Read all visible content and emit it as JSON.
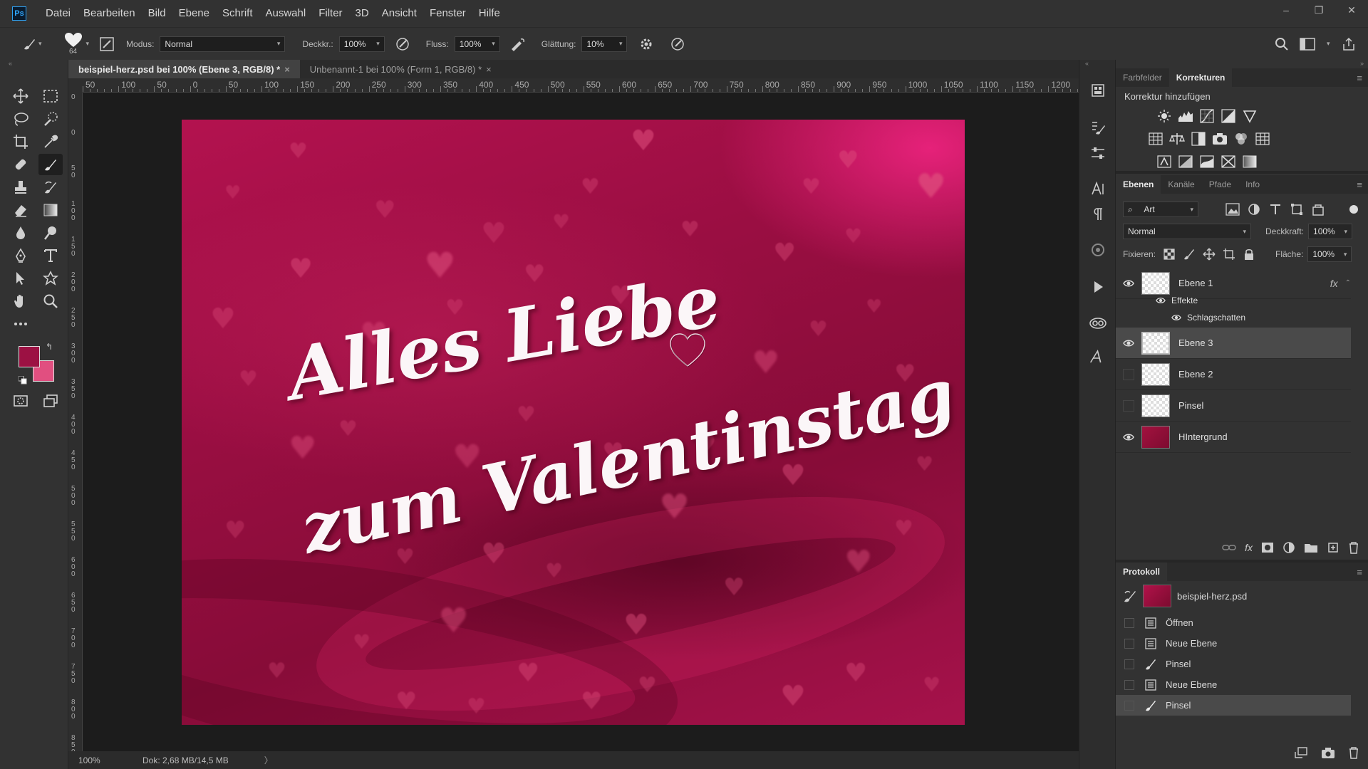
{
  "app": {
    "logo": "Ps",
    "menu": [
      "Datei",
      "Bearbeiten",
      "Bild",
      "Ebene",
      "Schrift",
      "Auswahl",
      "Filter",
      "3D",
      "Ansicht",
      "Fenster",
      "Hilfe"
    ],
    "window_controls": [
      "–",
      "❐",
      "✕"
    ]
  },
  "options": {
    "brush_size": "64",
    "modus_label": "Modus:",
    "modus_value": "Normal",
    "deckkr_label": "Deckkr.:",
    "deckkr_value": "100%",
    "fluss_label": "Fluss:",
    "fluss_value": "100%",
    "glaettung_label": "Glättung:",
    "glaettung_value": "10%"
  },
  "tabs": [
    {
      "label": "beispiel-herz.psd bei 100% (Ebene 3, RGB/8) *",
      "active": true
    },
    {
      "label": "Unbenannt-1 bei 100% (Form 1, RGB/8) *",
      "active": false
    }
  ],
  "ruler": {
    "h_labels": [
      "50",
      "100",
      "50",
      "0",
      "50",
      "100",
      "150",
      "200",
      "250",
      "300",
      "350",
      "400",
      "450",
      "500",
      "550",
      "600",
      "650",
      "700",
      "750",
      "800",
      "850",
      "900",
      "950",
      "1000",
      "1050",
      "1100",
      "1150",
      "1200"
    ],
    "v_labels": [
      "0",
      "0",
      "5 0",
      "1 0 0",
      "1 5 0",
      "2 0 0",
      "2 5 0",
      "3 0 0",
      "3 5 0",
      "4 0 0",
      "4 5 0",
      "5 0 0",
      "5 5 0",
      "6 0 0",
      "6 5 0",
      "7 0 0",
      "7 5 0",
      "8 0 0",
      "8 5 0"
    ]
  },
  "canvas": {
    "line1": "Alles Liebe",
    "line2": "zum Valentinstag",
    "heart_glyph": "♥"
  },
  "colors": {
    "foreground": "#9c1143",
    "background": "#e14f80"
  },
  "status": {
    "zoom": "100%",
    "doc": "Dok: 2,68 MB/14,5 MB",
    "arrow": "〉"
  },
  "corrections": {
    "tabs": [
      "Farbfelder",
      "Korrekturen"
    ],
    "active_tab": "Korrekturen",
    "title": "Korrektur hinzufügen"
  },
  "layers_panel": {
    "tabs": [
      "Ebenen",
      "Kanäle",
      "Pfade",
      "Info"
    ],
    "filter_kind": "Art",
    "blend_mode": "Normal",
    "opacity_label": "Deckkraft:",
    "opacity_value": "100%",
    "lock_label": "Fixieren:",
    "fill_label": "Fläche:",
    "fill_value": "100%",
    "fx_label": "fx",
    "layers": [
      {
        "name": "Ebene 1",
        "visible": true,
        "selected": false,
        "thumb": "check"
      },
      {
        "name": "Ebene 3",
        "visible": true,
        "selected": true,
        "thumb": "check"
      },
      {
        "name": "Ebene 2",
        "visible": false,
        "selected": false,
        "thumb": "check"
      },
      {
        "name": "Pinsel",
        "visible": false,
        "selected": false,
        "thumb": "check"
      },
      {
        "name": "HIntergrund",
        "visible": true,
        "selected": false,
        "thumb": "red"
      }
    ],
    "effects_label": "Effekte",
    "effect_name": "Schlagschatten"
  },
  "history": {
    "title": "Protokoll",
    "snapshot": "beispiel-herz.psd",
    "items": [
      {
        "name": "Öffnen",
        "icon": "document-icon",
        "selected": false
      },
      {
        "name": "Neue Ebene",
        "icon": "document-icon",
        "selected": false
      },
      {
        "name": "Pinsel",
        "icon": "brush-icon",
        "selected": false
      },
      {
        "name": "Neue Ebene",
        "icon": "document-icon",
        "selected": false
      },
      {
        "name": "Pinsel",
        "icon": "brush-icon",
        "selected": true
      }
    ]
  }
}
